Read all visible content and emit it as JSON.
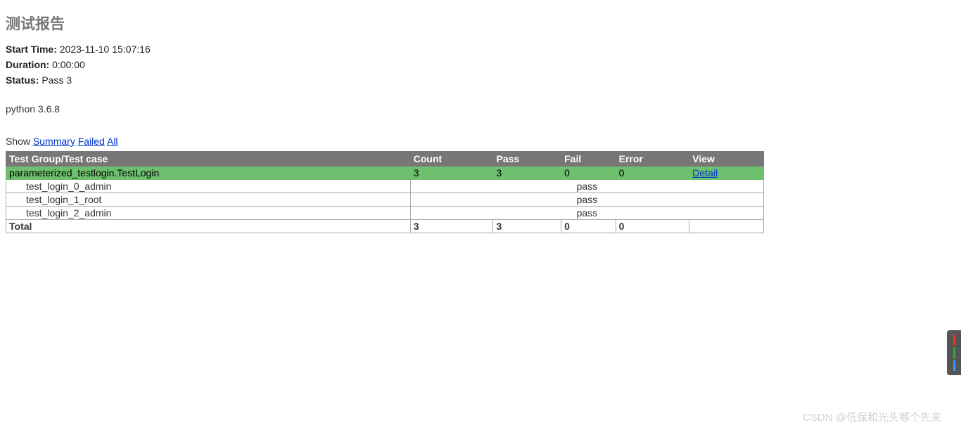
{
  "title": "测试报告",
  "meta": {
    "start_time_label": "Start Time:",
    "start_time_value": "2023-11-10 15:07:16",
    "duration_label": "Duration:",
    "duration_value": "0:00:00",
    "status_label": "Status:",
    "status_value": "Pass 3"
  },
  "environment": "python 3.6.8",
  "filters": {
    "show_label": "Show",
    "summary": "Summary",
    "failed": "Failed",
    "all": "All"
  },
  "headers": {
    "name": "Test Group/Test case",
    "count": "Count",
    "pass": "Pass",
    "fail": "Fail",
    "error": "Error",
    "view": "View"
  },
  "classRow": {
    "name": "parameterized_testlogin.TestLogin",
    "count": "3",
    "pass": "3",
    "fail": "0",
    "error": "0",
    "view": "Detail"
  },
  "cases": [
    {
      "name": "test_login_0_admin",
      "result": "pass"
    },
    {
      "name": "test_login_1_root",
      "result": "pass"
    },
    {
      "name": "test_login_2_admin",
      "result": "pass"
    }
  ],
  "total": {
    "label": "Total",
    "count": "3",
    "pass": "3",
    "fail": "0",
    "error": "0"
  },
  "watermark": "CSDN @低保和光头哪个先来"
}
